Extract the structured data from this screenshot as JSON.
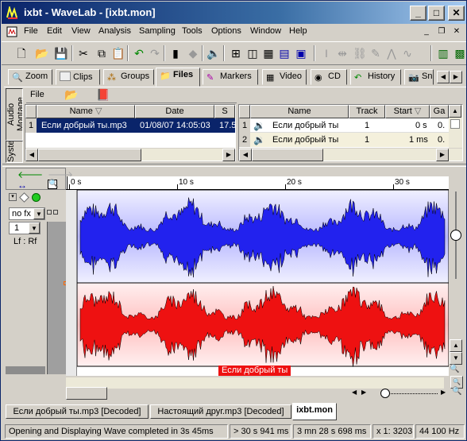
{
  "window": {
    "title": "ixbt - WaveLab - [ixbt.mon]"
  },
  "menu": [
    "File",
    "Edit",
    "View",
    "Analysis",
    "Sampling",
    "Tools",
    "Options",
    "Window",
    "Help"
  ],
  "tabs": [
    {
      "label": "Zoom"
    },
    {
      "label": "Clips"
    },
    {
      "label": "Groups"
    },
    {
      "label": "Files"
    },
    {
      "label": "Markers"
    },
    {
      "label": "Video"
    },
    {
      "label": "CD"
    },
    {
      "label": "History"
    },
    {
      "label": "Sn"
    }
  ],
  "side_tabs": {
    "top": "Audio Montage",
    "bottom": "Syste"
  },
  "file_panel": {
    "menu_label": "File",
    "headers": [
      "Name",
      "Date",
      "S"
    ],
    "rows": [
      {
        "index": "1",
        "name": "Если добрый ты.mp3",
        "date": "01/08/07 14:05:03",
        "size": "17.5"
      }
    ]
  },
  "clips_panel": {
    "headers": [
      "Name",
      "Track",
      "Start",
      "Ga"
    ],
    "rows": [
      {
        "index": "1",
        "name": "Если добрый ты",
        "track": "1",
        "start": "0 s",
        "gain": "0."
      },
      {
        "index": "2",
        "name": "Если добрый ты",
        "track": "1",
        "start": "1 ms",
        "gain": "0."
      }
    ]
  },
  "track_ctrl": {
    "fx": "no fx",
    "number": "1",
    "channels": "Lf : Rf"
  },
  "ruler": [
    "0 s",
    "10 s",
    "20 s",
    "30 s"
  ],
  "clip_label": "Если добрый ты",
  "doc_tabs": [
    "Если добрый ты.mp3 [Decoded]",
    "Настоящий друг.mp3 [Decoded]",
    "ixbt.mon"
  ],
  "status": {
    "message": "Opening and Displaying Wave completed in 3s 45ms",
    "pos": "> 30 s 941 ms",
    "length": "3 mn 28 s 698 ms",
    "zoom": "x 1: 3203",
    "rate": "44 100 Hz"
  },
  "colors": {
    "left_channel": "#2222ee",
    "right_channel": "#ee1111",
    "title_bar": "#0a246a"
  }
}
